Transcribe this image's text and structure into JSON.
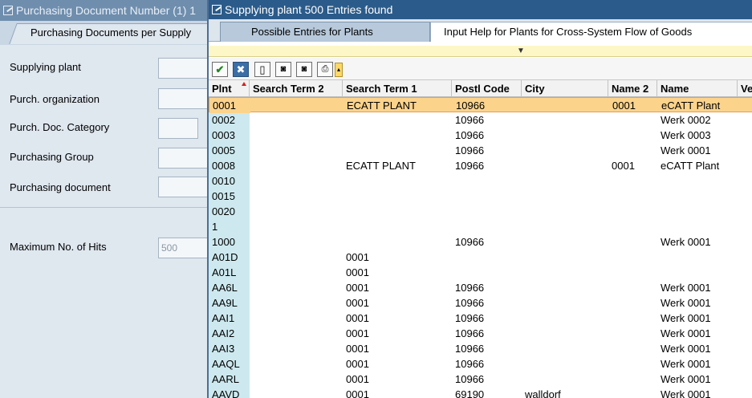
{
  "background_dialog": {
    "title": "Purchasing Document Number (1)  1",
    "tab_label": "Purchasing Documents per Supply",
    "fields": [
      {
        "label": "Supplying plant",
        "value": ""
      },
      {
        "label": "Purch. organization",
        "value": ""
      },
      {
        "label": "Purch. Doc. Category",
        "value": ""
      },
      {
        "label": "Purchasing Group",
        "value": ""
      },
      {
        "label": "Purchasing document",
        "value": ""
      }
    ],
    "max_hits_label": "Maximum No. of Hits",
    "max_hits_value": "500"
  },
  "popup": {
    "title": "Supplying plant  500 Entries found",
    "tabs": [
      {
        "label": "Possible Entries for Plants",
        "active": true
      },
      {
        "label": "Input Help for Plants for Cross-System Flow of Goods",
        "active": false
      }
    ],
    "toolbar_icons": [
      "checkmark-icon",
      "cancel-icon",
      "new-document-icon",
      "find-icon",
      "find-next-icon",
      "print-icon",
      "menu-dropdown-icon"
    ],
    "columns": [
      "Plnt",
      "Search Term 2",
      "Search Term 1",
      "Postl Code",
      "City",
      "Name 2",
      "Name",
      "Ve"
    ],
    "rows": [
      [
        "0001",
        "",
        "ECATT PLANT",
        "10966",
        "",
        "0001",
        "eCATT Plant"
      ],
      [
        "0002",
        "",
        "",
        "10966",
        "",
        "",
        "Werk 0002"
      ],
      [
        "0003",
        "",
        "",
        "10966",
        "",
        "",
        "Werk 0003"
      ],
      [
        "0005",
        "",
        "",
        "10966",
        "",
        "",
        "Werk 0001"
      ],
      [
        "0008",
        "",
        "ECATT PLANT",
        "10966",
        "",
        "0001",
        "eCATT Plant"
      ],
      [
        "0010",
        "",
        "",
        "",
        "",
        "",
        ""
      ],
      [
        "0015",
        "",
        "",
        "",
        "",
        "",
        ""
      ],
      [
        "0020",
        "",
        "",
        "",
        "",
        "",
        ""
      ],
      [
        "1",
        "",
        "",
        "",
        "",
        "",
        ""
      ],
      [
        "1000",
        "",
        "",
        "10966",
        "",
        "",
        "Werk 0001"
      ],
      [
        "A01D",
        "",
        "0001",
        "",
        "",
        "",
        ""
      ],
      [
        "A01L",
        "",
        "0001",
        "",
        "",
        "",
        ""
      ],
      [
        "AA6L",
        "",
        "0001",
        "10966",
        "",
        "",
        "Werk 0001"
      ],
      [
        "AA9L",
        "",
        "0001",
        "10966",
        "",
        "",
        "Werk 0001"
      ],
      [
        "AAI1",
        "",
        "0001",
        "10966",
        "",
        "",
        "Werk 0001"
      ],
      [
        "AAI2",
        "",
        "0001",
        "10966",
        "",
        "",
        "Werk 0001"
      ],
      [
        "AAI3",
        "",
        "0001",
        "10966",
        "",
        "",
        "Werk 0001"
      ],
      [
        "AAQL",
        "",
        "0001",
        "10966",
        "",
        "",
        "Werk 0001"
      ],
      [
        "AARL",
        "",
        "0001",
        "10966",
        "",
        "",
        "Werk 0001"
      ],
      [
        "AAVD",
        "",
        "0001",
        "69190",
        "walldorf",
        "",
        "Werk 0001"
      ]
    ],
    "selected_row": 0
  },
  "colors": {
    "popup_title_bg": "#2b5b8a",
    "selected_row_bg": "#fcd38b",
    "key_column_bg": "#cde9ef"
  }
}
